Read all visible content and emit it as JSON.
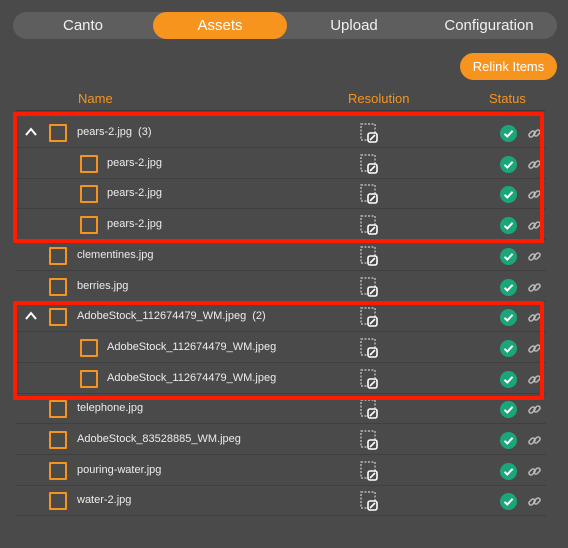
{
  "tabs": [
    {
      "label": "Canto",
      "active": false
    },
    {
      "label": "Assets",
      "active": true
    },
    {
      "label": "Upload",
      "active": false
    },
    {
      "label": "Configuration",
      "active": false
    }
  ],
  "toolbar": {
    "relink_label": "Relink Items"
  },
  "columns": {
    "name": "Name",
    "resolution": "Resolution",
    "status": "Status"
  },
  "colors": {
    "accent": "#f7941d",
    "status_ok": "#1aa67a",
    "annotation": "#ff1a00",
    "background": "#4a4a4a"
  },
  "icons": {
    "resolution": "missing-image-icon",
    "status": "check-circle-icon",
    "link": "link-icon",
    "expand": "chevron-up-icon"
  },
  "rows": [
    {
      "name": "pears-2.jpg",
      "count": "(3)",
      "group": true,
      "child": false
    },
    {
      "name": "pears-2.jpg",
      "count": "",
      "group": false,
      "child": true
    },
    {
      "name": "pears-2.jpg",
      "count": "",
      "group": false,
      "child": true
    },
    {
      "name": "pears-2.jpg",
      "count": "",
      "group": false,
      "child": true
    },
    {
      "name": "clementines.jpg",
      "count": "",
      "group": false,
      "child": false
    },
    {
      "name": "berries.jpg",
      "count": "",
      "group": false,
      "child": false
    },
    {
      "name": "AdobeStock_112674479_WM.jpeg",
      "count": "(2)",
      "group": true,
      "child": false
    },
    {
      "name": "AdobeStock_112674479_WM.jpeg",
      "count": "",
      "group": false,
      "child": true
    },
    {
      "name": "AdobeStock_112674479_WM.jpeg",
      "count": "",
      "group": false,
      "child": true
    },
    {
      "name": "telephone.jpg",
      "count": "",
      "group": false,
      "child": false
    },
    {
      "name": "AdobeStock_83528885_WM.jpeg",
      "count": "",
      "group": false,
      "child": false
    },
    {
      "name": "pouring-water.jpg",
      "count": "",
      "group": false,
      "child": false
    },
    {
      "name": "water-2.jpg",
      "count": "",
      "group": false,
      "child": false
    }
  ]
}
